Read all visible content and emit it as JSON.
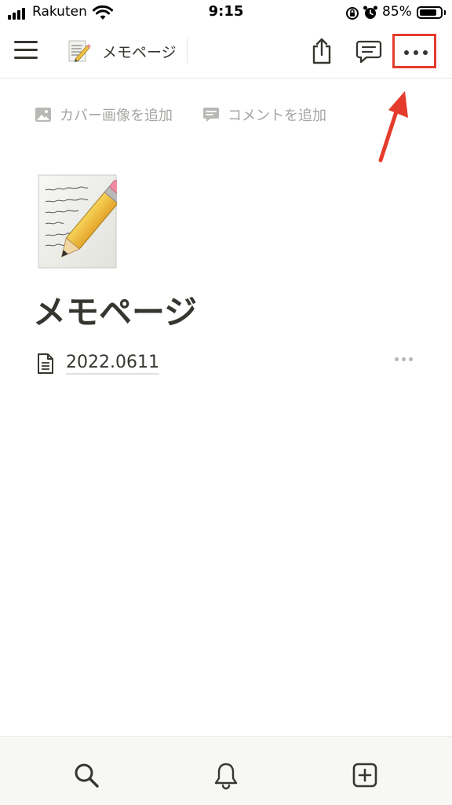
{
  "status_bar": {
    "carrier": "Rakuten",
    "time": "9:15",
    "battery_percent": "85%",
    "battery_level": 0.85,
    "icons": [
      "signal-icon",
      "wifi-icon",
      "rotation-lock-icon",
      "alarm-icon",
      "battery-icon"
    ]
  },
  "topbar": {
    "page_emoji": "memo-icon",
    "title": "メモページ",
    "icons": [
      "hamburger-menu-icon",
      "share-icon",
      "comment-icon",
      "more-icon"
    ]
  },
  "page_actions": {
    "add_cover": "カバー画像を追加",
    "add_comment": "コメントを追加"
  },
  "page": {
    "icon": "memo-icon",
    "title": "メモページ",
    "subpages": [
      {
        "title": "2022.0611"
      }
    ]
  },
  "annotation": {
    "highlight_color": "#e53b2c"
  },
  "bottom_tabs": {
    "icons": [
      "search-icon",
      "bell-icon",
      "new-page-icon"
    ]
  },
  "colors": {
    "text": "#37352f",
    "muted": "#a5a5a2",
    "bottom_bar": "#f7f7f5"
  }
}
